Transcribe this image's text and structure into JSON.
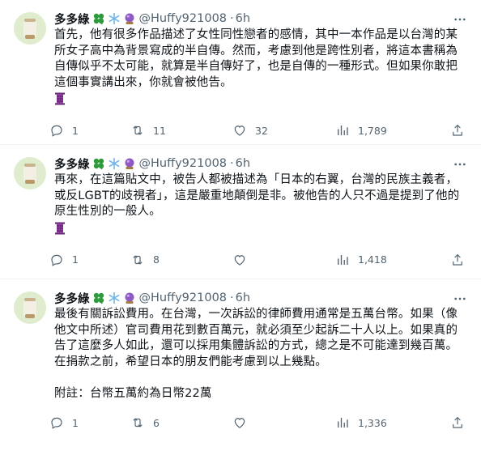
{
  "tweets": [
    {
      "display_name": "多多綠",
      "handle": "@Huffy921008",
      "time": "6h",
      "text": "首先，他有很多作品描述了女性同性戀者的感情，其中一本作品是以台灣的某所女子高中為背景寫成的半自傳。然而，考慮到他是跨性別者，將這本書稱為自傳似乎不太可能，就算是半自傳好了，也是自傳的一種形式。但如果你敢把這個事實講出來，你就會被他告。",
      "replies": "1",
      "retweets": "11",
      "likes": "32",
      "views": "1,789"
    },
    {
      "display_name": "多多綠",
      "handle": "@Huffy921008",
      "time": "6h",
      "text": "再來，在這篇貼文中，被告人都被描述為「日本的右翼，台灣的民族主義者，或反LGBT的歧視者」，這是嚴重地顛倒是非。被他告的人只不過是提到了他的原生性別的一般人。",
      "replies": "1",
      "retweets": "8",
      "likes": "",
      "views": "1,418"
    },
    {
      "display_name": "多多綠",
      "handle": "@Huffy921008",
      "time": "6h",
      "text": "最後有關訴訟費用。在台灣，一次訴訟的律師費用通常是五萬台幣。如果（像他文中所述）官司費用花到數百萬元，就必須至少起訴二十人以上。如果真的告了這麼多人如此，還可以採用集體訴訟的方式，總之是不可能達到幾百萬。在捐款之前，希望日本的朋友們能考慮到以上幾點。\n\n附註：台幣五萬約為日幣22萬",
      "replies": "1",
      "retweets": "6",
      "likes": "",
      "views": "1,336"
    }
  ],
  "icons": {
    "clover": "four-leaf-clover-icon",
    "snowflake": "snowflake-icon",
    "crystal_ball": "crystal-ball-icon",
    "spool": "spool-icon"
  },
  "colors": {
    "text": "#0f1419",
    "secondary": "#536471",
    "divider": "#eff3f4",
    "clover": "#2e9a3c",
    "snowflake": "#6fb6e9",
    "crystal": "#8e5bc4",
    "spool": "#6a2a7a"
  }
}
